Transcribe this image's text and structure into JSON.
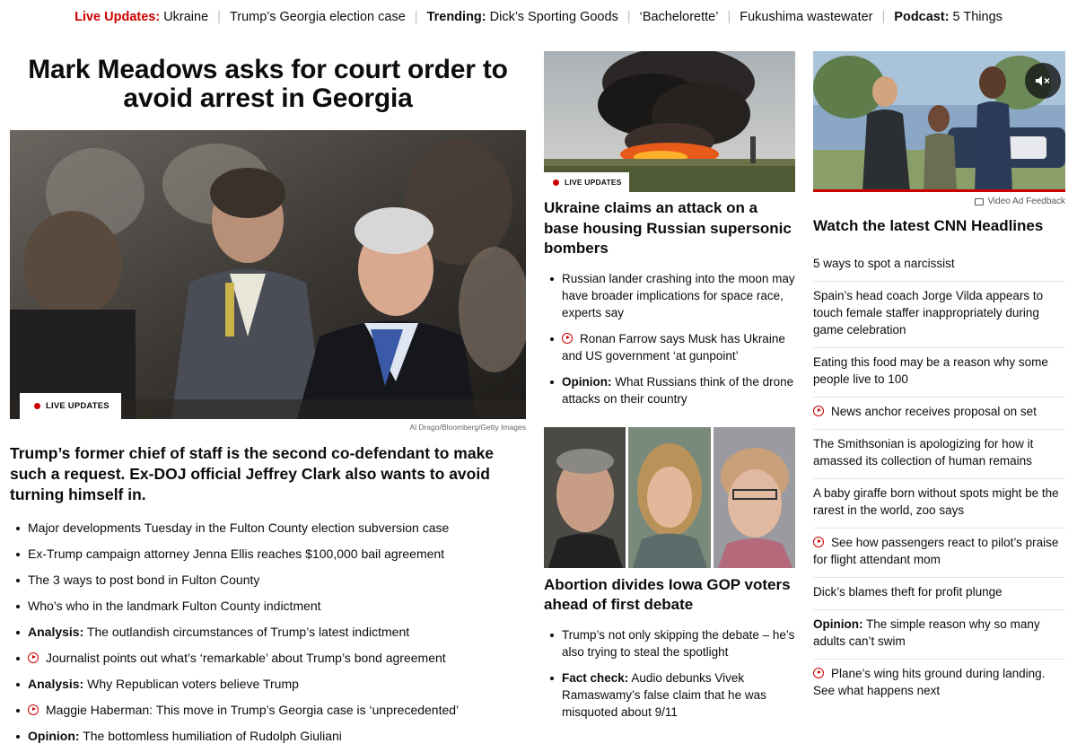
{
  "topbar": {
    "items": [
      {
        "label": "Live Updates:",
        "text": "Ukraine",
        "style": "live"
      },
      {
        "label": "",
        "text": "Trump’s Georgia election case",
        "style": "plain"
      },
      {
        "label": "Trending:",
        "text": "Dick’s Sporting Goods",
        "style": "bold"
      },
      {
        "label": "",
        "text": "‘Bachelorette’",
        "style": "plain"
      },
      {
        "label": "",
        "text": "Fukushima wastewater",
        "style": "plain"
      },
      {
        "label": "Podcast:",
        "text": "5 Things",
        "style": "bold"
      }
    ]
  },
  "lead": {
    "headline": "Mark Meadows asks for court order to avoid arrest in Georgia",
    "live_badge": "LIVE UPDATES",
    "credit": "Al Drago/Bloomberg/Getty Images",
    "subhead": "Trump’s former chief of staff is the second co-defendant to make such a request. Ex-DOJ official Jeffrey Clark also wants to avoid turning himself in.",
    "bullets": [
      {
        "label": "",
        "text": "Major developments Tuesday in the Fulton County election subversion case",
        "video": false
      },
      {
        "label": "",
        "text": "Ex-Trump campaign attorney Jenna Ellis reaches $100,000 bail agreement",
        "video": false
      },
      {
        "label": "",
        "text": "The 3 ways to post bond in Fulton County",
        "video": false
      },
      {
        "label": "",
        "text": "Who’s who in the landmark Fulton County indictment",
        "video": false
      },
      {
        "label": "Analysis:",
        "text": "The outlandish circumstances of Trump’s latest indictment",
        "video": false
      },
      {
        "label": "",
        "text": "Journalist points out what’s ‘remarkable’ about Trump’s bond agreement",
        "video": true
      },
      {
        "label": "Analysis:",
        "text": "Why Republican voters believe Trump",
        "video": false
      },
      {
        "label": "",
        "text": "Maggie Haberman: This move in Trump’s Georgia case is ‘unprecedented’",
        "video": true
      },
      {
        "label": "Opinion:",
        "text": "The bottomless humiliation of Rudolph Giuliani",
        "video": false
      }
    ]
  },
  "ukraine": {
    "live_badge": "LIVE UPDATES",
    "headline": "Ukraine claims an attack on a base housing Russian supersonic bombers",
    "bullets": [
      {
        "label": "",
        "text": "Russian lander crashing into the moon may have broader implications for space race, experts say",
        "video": false
      },
      {
        "label": "",
        "text": "Ronan Farrow says Musk has Ukraine and US government ‘at gunpoint’",
        "video": true
      },
      {
        "label": "Opinion:",
        "text": "What Russians think of the drone attacks on their country",
        "video": false
      }
    ]
  },
  "abortion": {
    "headline": "Abortion divides Iowa GOP voters ahead of first debate",
    "bullets": [
      {
        "label": "",
        "text": "Trump’s not only skipping the debate – he’s also trying to steal the spotlight",
        "video": false
      },
      {
        "label": "Fact check:",
        "text": "Audio debunks Vivek Ramaswamy’s false claim that he was misquoted about 9/11",
        "video": false
      }
    ]
  },
  "video": {
    "ad_feedback": "Video Ad Feedback",
    "headline": "Watch the latest CNN Headlines",
    "items": [
      {
        "label": "",
        "text": "5 ways to spot a narcissist",
        "video": false
      },
      {
        "label": "",
        "text": "Spain’s head coach Jorge Vilda appears to touch female staffer inappropriately during game celebration",
        "video": false
      },
      {
        "label": "",
        "text": "Eating this food may be a reason why some people live to 100",
        "video": false
      },
      {
        "label": "",
        "text": "News anchor receives proposal on set",
        "video": true
      },
      {
        "label": "",
        "text": "The Smithsonian is apologizing for how it amassed its collection of human remains",
        "video": false
      },
      {
        "label": "",
        "text": "A baby giraffe born without spots might be the rarest in the world, zoo says",
        "video": false
      },
      {
        "label": "",
        "text": "See how passengers react to pilot’s praise for flight attendant mom",
        "video": true
      },
      {
        "label": "",
        "text": "Dick’s blames theft for profit plunge",
        "video": false
      },
      {
        "label": "Opinion:",
        "text": "The simple reason why so many adults can’t swim",
        "video": false
      },
      {
        "label": "",
        "text": "Plane’s wing hits ground during landing. See what happens next",
        "video": true
      }
    ]
  },
  "colors": {
    "accent": "#cc0000",
    "text": "#0c0c0c",
    "divider": "#e6e6e6"
  }
}
